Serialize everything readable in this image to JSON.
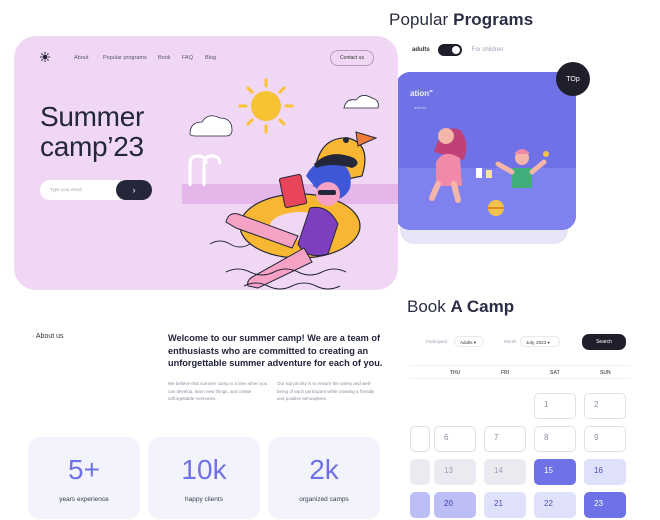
{
  "programs": {
    "title_light": "Popular",
    "title_bold": "Programs",
    "toggle_left": "adults",
    "toggle_right": "For children",
    "card_quote": "ation\"",
    "card_sub": "activity",
    "badge": "TOp"
  },
  "hero": {
    "nav": [
      "About",
      "Popular programs",
      "Book",
      "FAQ",
      "Blog"
    ],
    "contact": "Contact us",
    "title": "Summer\ncamp’23",
    "email_placeholder": "Type your email",
    "email_go": "›"
  },
  "about": {
    "label": "About us",
    "lead": "Welcome to our summer camp! We are a team of enthusiasts who are committed to creating an unforgettable summer adventure for each of you.",
    "p1": "We believe that summer camp is a time when you can develop, learn new things, and create unforgettable memories.",
    "p2": "Our top priority is to ensure the safety and well-being of each participant while creating a friendly and positive atmosphere."
  },
  "stats": [
    {
      "value": "5+",
      "caption": "years experience"
    },
    {
      "value": "10k",
      "caption": "happy clients"
    },
    {
      "value": "2k",
      "caption": "organized camps"
    }
  ],
  "booking": {
    "title_light": "Book",
    "title_bold": "A Camp",
    "participant_label": "Participant",
    "participant_value": "Adults",
    "month_label": "Month",
    "month_value": "July, 2023",
    "search": "Search",
    "days": [
      "THU",
      "FRI",
      "SAT",
      "SUN"
    ],
    "dates": [
      "1",
      "2",
      "6",
      "7",
      "8",
      "9",
      "13",
      "14",
      "15",
      "16",
      "20",
      "21",
      "22",
      "23"
    ]
  }
}
